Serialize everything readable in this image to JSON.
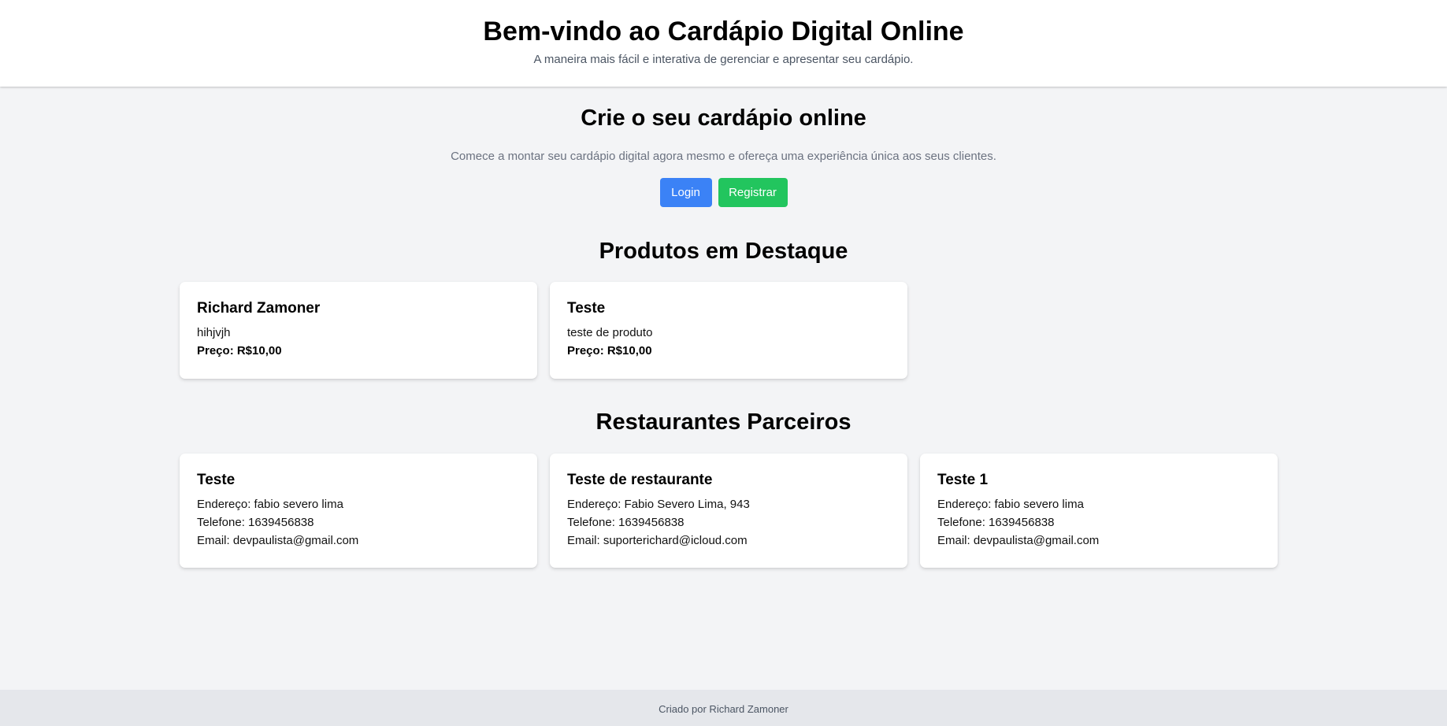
{
  "header": {
    "title": "Bem-vindo ao Cardápio Digital Online",
    "subtitle": "A maneira mais fácil e interativa de gerenciar e apresentar seu cardápio."
  },
  "hero": {
    "title": "Crie o seu cardápio online",
    "text": "Comece a montar seu cardápio digital agora mesmo e ofereça uma experiência única aos seus clientes.",
    "login_label": "Login",
    "register_label": "Registrar"
  },
  "products": {
    "title": "Produtos em Destaque",
    "items": [
      {
        "name": "Richard Zamoner",
        "description": "hihjvjh",
        "price": "Preço: R$10,00"
      },
      {
        "name": "Teste",
        "description": "teste de produto",
        "price": "Preço: R$10,00"
      }
    ]
  },
  "restaurants": {
    "title": "Restaurantes Parceiros",
    "items": [
      {
        "name": "Teste",
        "address": "Endereço: fabio severo lima",
        "phone": "Telefone: 1639456838",
        "email": "Email: devpaulista@gmail.com"
      },
      {
        "name": "Teste de restaurante",
        "address": "Endereço: Fabio Severo Lima, 943",
        "phone": "Telefone: 1639456838",
        "email": "Email: suporterichard@icloud.com"
      },
      {
        "name": "Teste 1",
        "address": "Endereço: fabio severo lima",
        "phone": "Telefone: 1639456838",
        "email": "Email: devpaulista@gmail.com"
      }
    ]
  },
  "footer": {
    "text": "Criado por Richard Zamoner"
  },
  "colors": {
    "login_button": "#3b82f6",
    "register_button": "#22c55e",
    "background": "#f3f4f6"
  }
}
